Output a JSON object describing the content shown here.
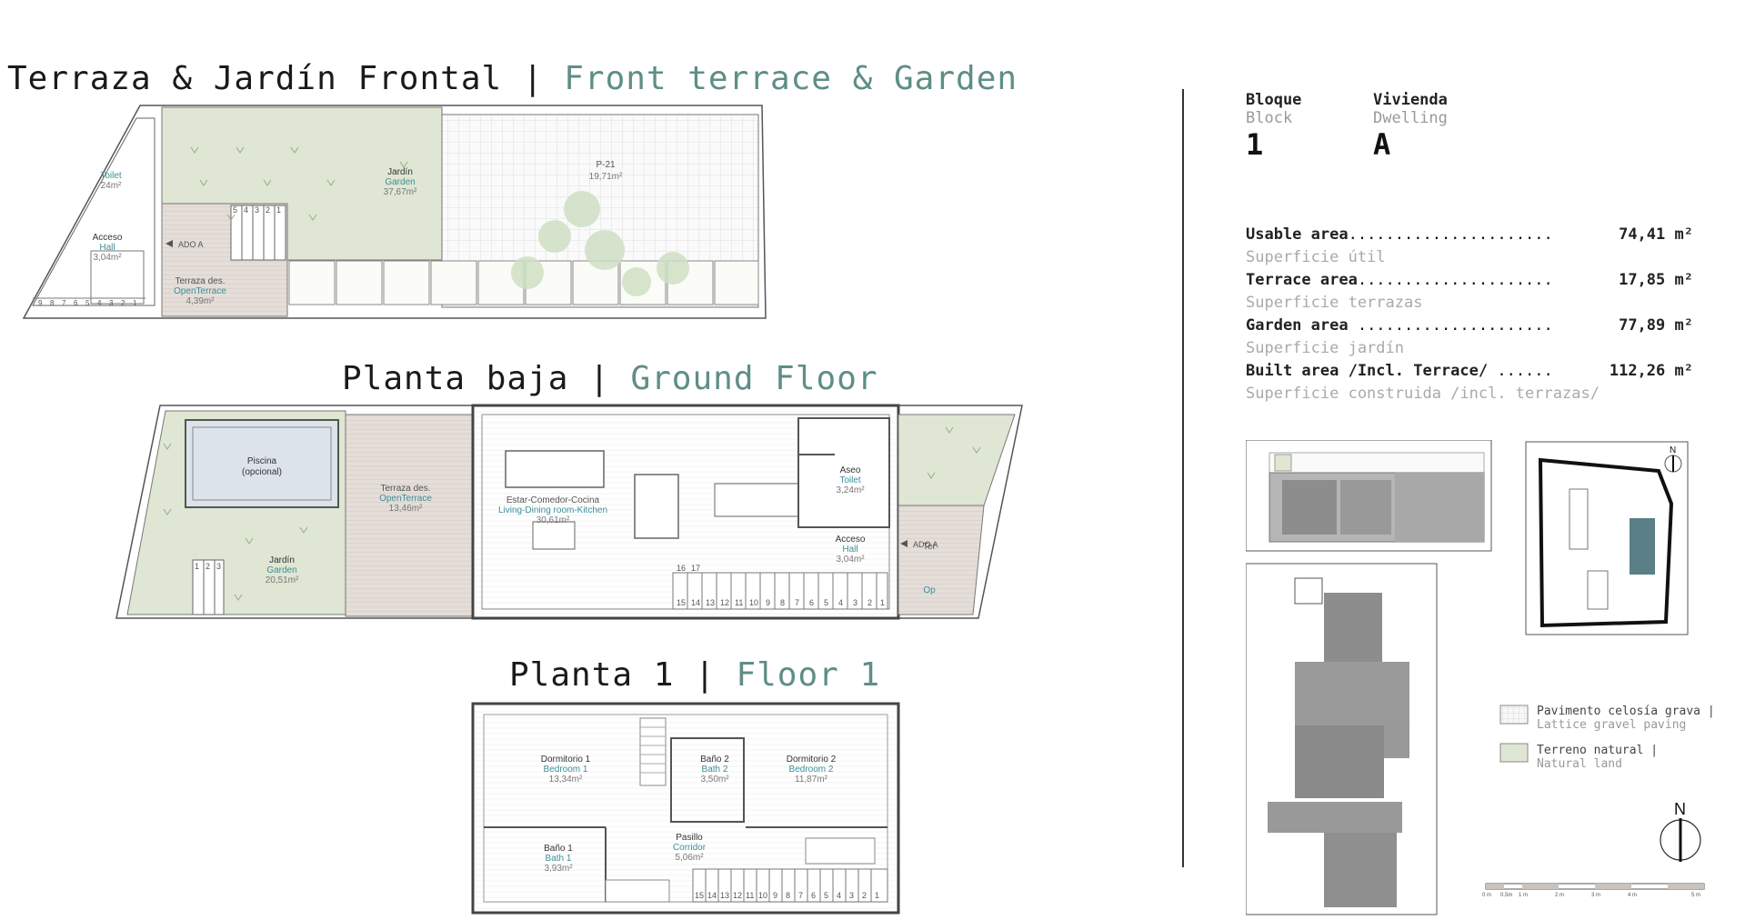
{
  "titles": {
    "front": {
      "es": "Terraza & Jardín Frontal |",
      "en": "Front terrace & Garden"
    },
    "ground": {
      "es": "Planta baja |",
      "en": "Ground Floor"
    },
    "floor1": {
      "es": "Planta 1 |",
      "en": "Floor 1"
    }
  },
  "header": {
    "block_label": "Bloque",
    "block_label_en": "Block",
    "block_value": "1",
    "dwelling_label": "Vivienda",
    "dwelling_label_en": "Dwelling",
    "dwelling_value": "A"
  },
  "areas": [
    {
      "label": "Usable area",
      "dots": "......................",
      "value": "74,41",
      "unit": "m²",
      "sub": "Superficie útil"
    },
    {
      "label": "Terrace area",
      "dots": ".....................",
      "value": "17,85",
      "unit": "m²",
      "sub": "Superficie terrazas"
    },
    {
      "label": "Garden area",
      "dots": " .....................",
      "value": "77,89",
      "unit": "m²",
      "sub": "Superficie jardín"
    },
    {
      "label": "Built area /Incl. Terrace/",
      "dots": " ......",
      "value": "112,26",
      "unit": "m²",
      "sub": "Superficie construida /incl. terrazas/"
    }
  ],
  "legend": [
    {
      "es": "Pavimento celosía grava |",
      "en": "Lattice gravel paving"
    },
    {
      "es": "Terreno natural |",
      "en": "Natural land"
    }
  ],
  "north": "N",
  "plan_labels": {
    "front": [
      {
        "es": "Jardín",
        "en": "Garden",
        "area": "37,67m²"
      },
      {
        "es": "P-21",
        "en": "",
        "area": "19,71m²"
      },
      {
        "es": "Acceso",
        "en": "Hall",
        "area": "3,04m²"
      },
      {
        "es": "Terraza des.",
        "en": "OpenTerrace",
        "area": "4,39m²"
      },
      {
        "es": "",
        "en": "Toilet",
        "area": "24m²"
      },
      {
        "es": "ADO A",
        "en": "",
        "area": ""
      }
    ],
    "ground": [
      {
        "es": "Piscina",
        "en": "(opcional)",
        "area": ""
      },
      {
        "es": "Terraza des.",
        "en": "OpenTerrace",
        "area": "13,46m²"
      },
      {
        "es": "Estar-Comedor-Cocina",
        "en": "Living-Dining room-Kitchen",
        "area": "30,61m²"
      },
      {
        "es": "Aseo",
        "en": "Toilet",
        "area": "3,24m²"
      },
      {
        "es": "Acceso",
        "en": "Hall",
        "area": "3,04m²"
      },
      {
        "es": "Jardín",
        "en": "Garden",
        "area": "20,51m²"
      },
      {
        "es": "ADO A",
        "en": "",
        "area": ""
      },
      {
        "es": "Ter",
        "en": "Op",
        "area": ""
      }
    ],
    "floor1": [
      {
        "es": "Dormitorio 1",
        "en": "Bedroom 1",
        "area": "13,34m²"
      },
      {
        "es": "Baño 2",
        "en": "Bath 2",
        "area": "3,50m²"
      },
      {
        "es": "Dormitorio 2",
        "en": "Bedroom 2",
        "area": "11,87m²"
      },
      {
        "es": "Baño 1",
        "en": "Bath 1",
        "area": "3,93m²"
      },
      {
        "es": "Pasillo",
        "en": "Corridor",
        "area": "5,06m²"
      }
    ]
  },
  "stairs_front": [
    "5",
    "4",
    "3",
    "2",
    "1"
  ],
  "stairs_front_low": [
    "9",
    "8",
    "7",
    "6",
    "5",
    "4",
    "3",
    "2",
    "1"
  ],
  "stairs_ground": [
    "15",
    "14",
    "13",
    "12",
    "11",
    "10",
    "9",
    "8",
    "7",
    "6",
    "5",
    "4",
    "3",
    "2",
    "1"
  ],
  "stairs_ground_top": [
    "16",
    "17"
  ],
  "stairs_floor1": [
    "15",
    "14",
    "13",
    "12",
    "11",
    "10",
    "9",
    "8",
    "7",
    "6",
    "5",
    "4",
    "3",
    "2",
    "1"
  ],
  "stairs_garden": [
    "1",
    "2",
    "3"
  ],
  "scale_labels": [
    "0 m",
    "0.5m",
    "1 m",
    "2 m",
    "3 m",
    "4 m",
    "5 m"
  ],
  "colors": {
    "accent": "#5e8e86",
    "garden": "#dfe6d3",
    "terrace": "#e2dcd7",
    "plan_dark": "#8d8d8d"
  }
}
